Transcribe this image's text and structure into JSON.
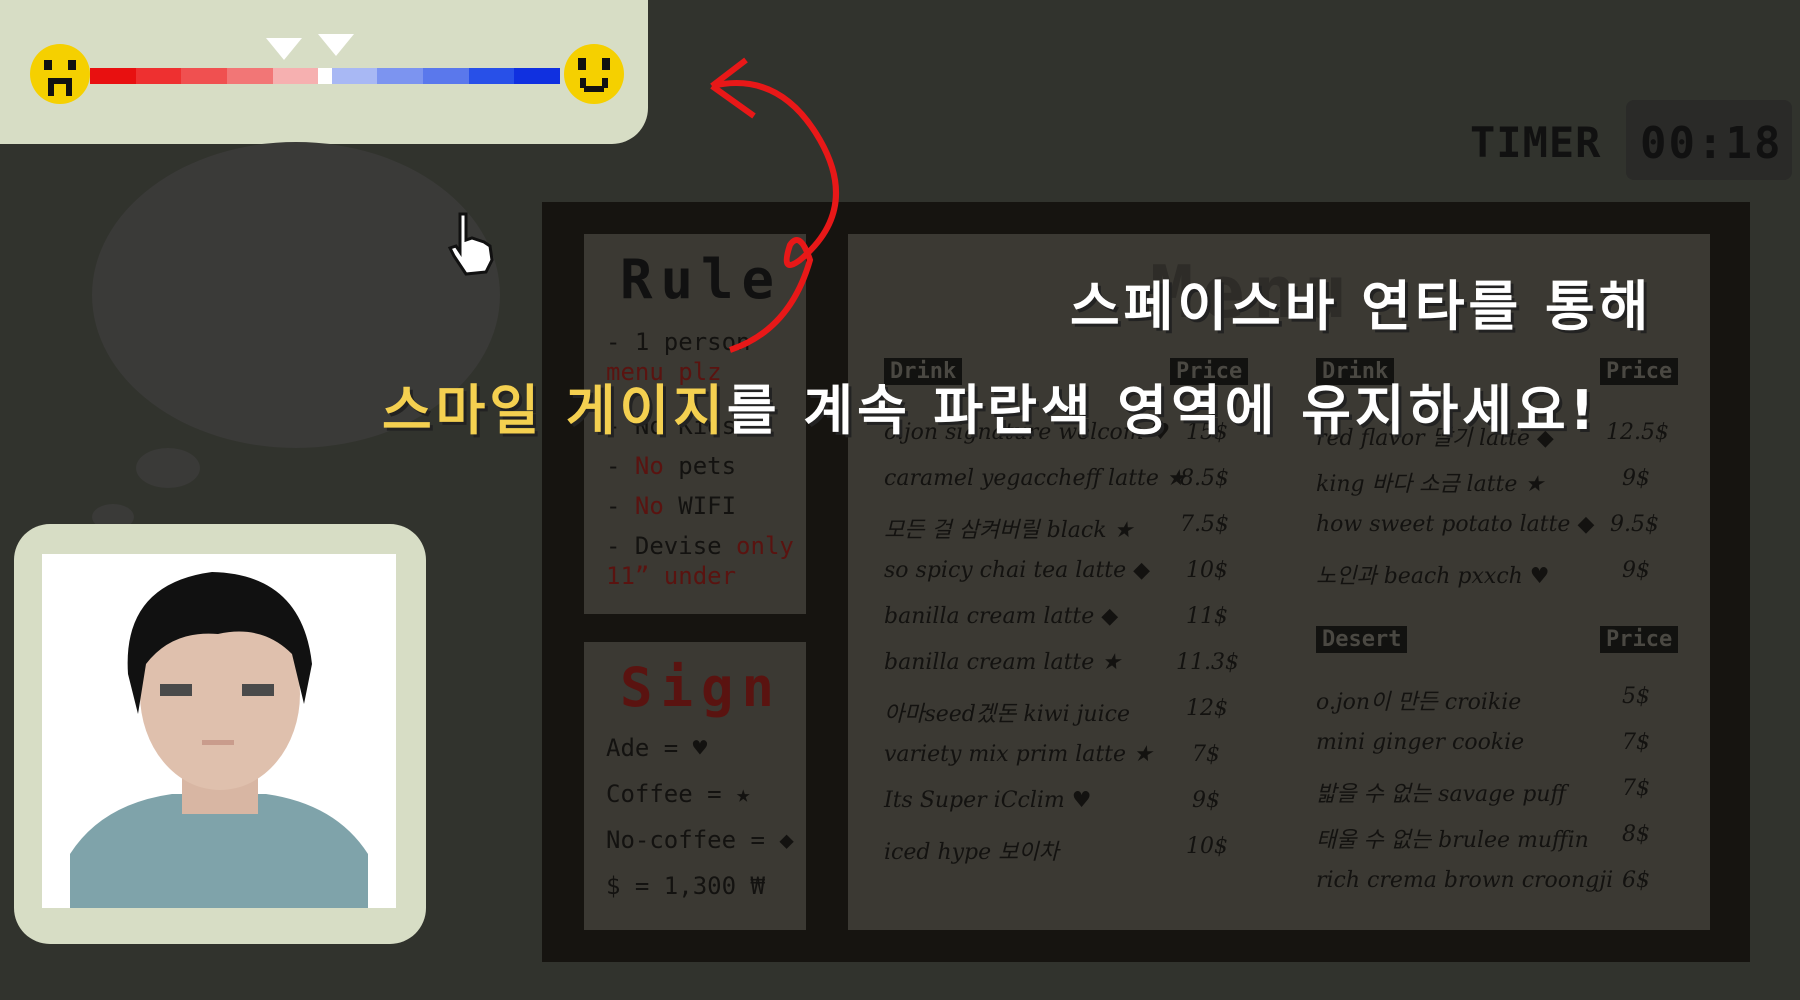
{
  "gauge": {
    "left_face_icon": "sad-face-icon",
    "right_face_icon": "happy-face-icon",
    "segments": [
      "#e81010",
      "#ee3030",
      "#f05050",
      "#f27676",
      "#f6b0b0",
      "#ffffff",
      "#a8b8f4",
      "#7c94f0",
      "#5a78ec",
      "#2850e8",
      "#1030e0"
    ],
    "marker_positions": [
      0.44,
      0.5
    ]
  },
  "timer": {
    "label": "TIMER",
    "value": "00:18"
  },
  "rule": {
    "title": "Rule",
    "lines": [
      {
        "prefix": "- 1 person ",
        "red": ""
      },
      {
        "prefix": "",
        "red": "menu plz"
      },
      {
        "prefix": "- No Kids",
        "red": ""
      },
      {
        "prefix": "- ",
        "red": "No",
        "suffix": " pets"
      },
      {
        "prefix": "- ",
        "red": "No",
        "suffix": " WIFI"
      },
      {
        "prefix": "- Devise ",
        "red": "only"
      },
      {
        "prefix": "",
        "red": "11” under"
      }
    ]
  },
  "sign": {
    "title": "Sign",
    "lines": [
      "Ade  =  ♥",
      "Coffee  =  ★",
      "No-coffee  =  ◆",
      "$ = 1,300 ₩"
    ]
  },
  "menu": {
    "title": "Menu",
    "drink_header": "Drink",
    "price_header": "Price",
    "desert_header": "Desert",
    "left_items": [
      {
        "name": "o.jon signature welcom ♥",
        "price": "15$"
      },
      {
        "name": "caramel yegaccheff latte ★",
        "price": "8.5$"
      },
      {
        "name": "모든 걸 삼켜버릴 black ★",
        "price": "7.5$"
      },
      {
        "name": "so spicy chai tea latte ◆",
        "price": "10$"
      },
      {
        "name": "banilla cream latte ◆",
        "price": "11$"
      },
      {
        "name": "banilla cream latte ★",
        "price": "11.3$"
      },
      {
        "name": "아마seed겠돈 kiwi juice",
        "price": "12$"
      },
      {
        "name": "variety mix prim latte ★",
        "price": "7$"
      },
      {
        "name": "Its Super iCclim ♥",
        "price": "9$"
      },
      {
        "name": "iced hype 보이차",
        "price": "10$"
      }
    ],
    "right_items": [
      {
        "name": "red flavor 딸기 latte ◆",
        "price": "12.5$"
      },
      {
        "name": "king 바다 소금 latte ★",
        "price": "9$"
      },
      {
        "name": "how sweet potato latte ◆",
        "price": "9.5$"
      },
      {
        "name": "노인과 beach pxxch ♥",
        "price": "9$"
      }
    ],
    "desert_items": [
      {
        "name": "o.jon이 만든 croikie",
        "price": "5$"
      },
      {
        "name": "mini ginger cookie",
        "price": "7$"
      },
      {
        "name": "밟을 수 없는 savage puff",
        "price": "7$"
      },
      {
        "name": "태울 수 없는 brulee muffin",
        "price": "8$"
      },
      {
        "name": "rich crema brown croongji",
        "price": "6$"
      }
    ]
  },
  "overlay": {
    "line1": "스페이스바 연타를 통해",
    "line2_hl1": "스마일",
    "line2_hl2": "게이지",
    "line2_rest": "를 계속 파란색 영역에 유지하세요!"
  },
  "icons": {
    "cursor": "hand-cursor-icon",
    "arrow": "curved-arrow-icon"
  }
}
